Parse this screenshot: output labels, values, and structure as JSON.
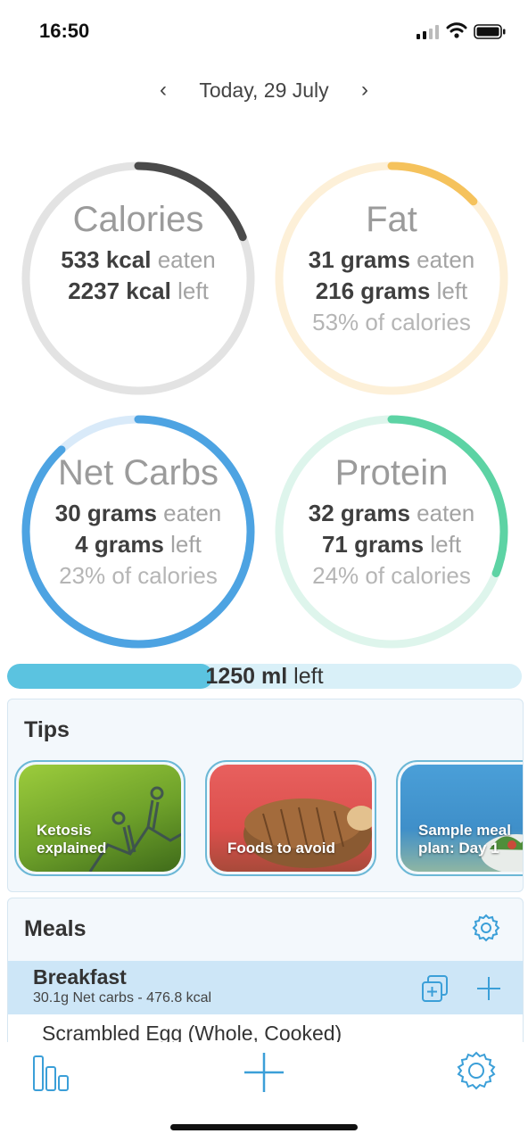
{
  "status_bar": {
    "time": "16:50"
  },
  "date_nav": {
    "label": "Today, 29 July",
    "prev_glyph": "‹",
    "next_glyph": "›"
  },
  "rings": {
    "calories": {
      "title": "Calories",
      "eaten_value": "533 kcal",
      "eaten_suffix": "eaten",
      "left_value": "2237 kcal",
      "left_suffix": "left",
      "progress": 0.19,
      "color": "#4a4a4a",
      "track": "#e3e3e3"
    },
    "fat": {
      "title": "Fat",
      "eaten_value": "31 grams",
      "eaten_suffix": "eaten",
      "left_value": "216 grams",
      "left_suffix": "left",
      "percent": "53% of calories",
      "progress": 0.13,
      "color": "#f5c25c",
      "track": "#fdf0d8"
    },
    "net_carbs": {
      "title": "Net Carbs",
      "eaten_value": "30 grams",
      "eaten_suffix": "eaten",
      "left_value": "4 grams",
      "left_suffix": "left",
      "percent": "23% of calories",
      "progress": 0.88,
      "color": "#4da3e2",
      "track": "#d9eaf9"
    },
    "protein": {
      "title": "Protein",
      "eaten_value": "32 grams",
      "eaten_suffix": "eaten",
      "left_value": "71 grams",
      "left_suffix": "left",
      "percent": "24% of calories",
      "progress": 0.31,
      "color": "#5dd3a4",
      "track": "#def5ec"
    }
  },
  "water": {
    "value": "1250 ml",
    "suffix": "left",
    "progress": 0.4
  },
  "tips": {
    "title": "Tips",
    "items": [
      {
        "label_line1": "Ketosis",
        "label_line2": "explained"
      },
      {
        "label_line1": "Foods to avoid",
        "label_line2": ""
      },
      {
        "label_line1": "Sample meal",
        "label_line2": "plan: Day 1"
      }
    ]
  },
  "meals": {
    "title": "Meals",
    "breakfast": {
      "title": "Breakfast",
      "summary": "30.1g Net carbs - 476.8 kcal"
    },
    "food_item": "Scrambled Egg (Whole, Cooked)"
  },
  "icons": {
    "meals_settings": "gear-icon",
    "copy": "copy-icon",
    "add": "plus-icon",
    "tab_stats": "bar-chart-icon",
    "tab_add": "plus-icon",
    "tab_settings": "gear-icon"
  }
}
